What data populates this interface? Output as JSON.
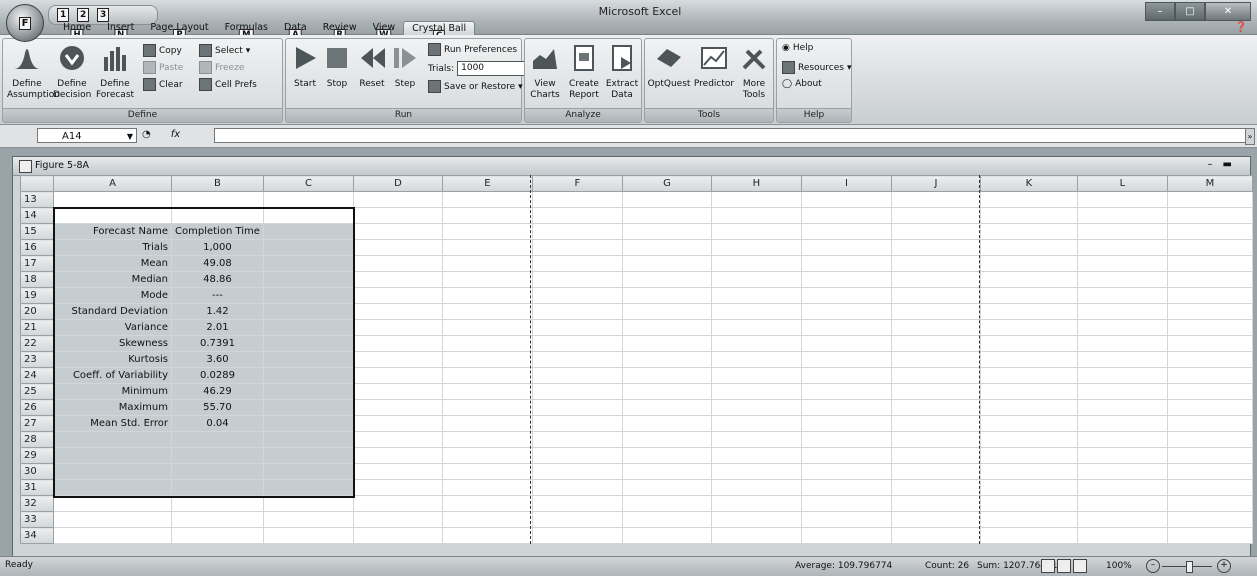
{
  "app": {
    "title": "Microsoft Excel"
  },
  "office_button": {
    "keytip": "F"
  },
  "qat": {
    "keytips": [
      "1",
      "2",
      "3"
    ]
  },
  "tabs": [
    {
      "label": "Home",
      "keytip": "H"
    },
    {
      "label": "Insert",
      "keytip": "N"
    },
    {
      "label": "Page Layout",
      "keytip": "P"
    },
    {
      "label": "Formulas",
      "keytip": "M"
    },
    {
      "label": "Data",
      "keytip": "A"
    },
    {
      "label": "Review",
      "keytip": "R"
    },
    {
      "label": "View",
      "keytip": "W"
    },
    {
      "label": "Crystal Ball",
      "keytip": "C",
      "active": true
    }
  ],
  "ribbon": {
    "define": {
      "label": "Define",
      "assumption": "Define\nAssumption",
      "decision": "Define\nDecision",
      "forecast": "Define\nForecast",
      "copy": "Copy",
      "paste": "Paste",
      "clear": "Clear",
      "select": "Select",
      "freeze": "Freeze",
      "cell_prefs": "Cell Prefs"
    },
    "run": {
      "label": "Run",
      "start": "Start",
      "stop": "Stop",
      "reset": "Reset",
      "step": "Step",
      "run_preferences": "Run Preferences",
      "trials_label": "Trials:",
      "trials_value": "1000",
      "save_restore": "Save or Restore"
    },
    "analyze": {
      "label": "Analyze",
      "view_charts": "View\nCharts",
      "create_report": "Create\nReport",
      "extract_data": "Extract\nData"
    },
    "tools": {
      "label": "Tools",
      "optquest": "OptQuest",
      "predictor": "Predictor",
      "more_tools": "More\nTools"
    },
    "help": {
      "label": "Help",
      "help": "Help",
      "resources": "Resources",
      "about": "About"
    }
  },
  "formula_bar": {
    "name_box": "A14",
    "fx": "fx",
    "formula": ""
  },
  "workbook": {
    "title": "Figure 5-8A"
  },
  "columns": [
    "A",
    "B",
    "C",
    "D",
    "E",
    "F",
    "G",
    "H",
    "I",
    "J",
    "K",
    "L",
    "M"
  ],
  "rows": [
    {
      "n": "13",
      "a": "",
      "b": ""
    },
    {
      "n": "14",
      "a": "",
      "b": ""
    },
    {
      "n": "15",
      "a": "Forecast Name",
      "b": "Completion Time"
    },
    {
      "n": "16",
      "a": "Trials",
      "b": "1,000"
    },
    {
      "n": "17",
      "a": "Mean",
      "b": "49.08"
    },
    {
      "n": "18",
      "a": "Median",
      "b": "48.86"
    },
    {
      "n": "19",
      "a": "Mode",
      "b": "---"
    },
    {
      "n": "20",
      "a": "Standard Deviation",
      "b": "1.42"
    },
    {
      "n": "21",
      "a": "Variance",
      "b": "2.01"
    },
    {
      "n": "22",
      "a": "Skewness",
      "b": "0.7391"
    },
    {
      "n": "23",
      "a": "Kurtosis",
      "b": "3.60"
    },
    {
      "n": "24",
      "a": "Coeff. of Variability",
      "b": "0.0289"
    },
    {
      "n": "25",
      "a": "Minimum",
      "b": "46.29"
    },
    {
      "n": "26",
      "a": "Maximum",
      "b": "55.70"
    },
    {
      "n": "27",
      "a": "Mean Std. Error",
      "b": "0.04"
    },
    {
      "n": "28",
      "a": "",
      "b": ""
    },
    {
      "n": "29",
      "a": "",
      "b": ""
    },
    {
      "n": "30",
      "a": "",
      "b": ""
    },
    {
      "n": "31",
      "a": "",
      "b": ""
    },
    {
      "n": "32",
      "a": "",
      "b": ""
    },
    {
      "n": "33",
      "a": "",
      "b": ""
    },
    {
      "n": "34",
      "a": "",
      "b": ""
    }
  ],
  "status": {
    "ready": "Ready",
    "average": "Average: 109.796774",
    "count": "Count: 26",
    "sum": "Sum: 1207.764514",
    "zoom": "100%"
  }
}
